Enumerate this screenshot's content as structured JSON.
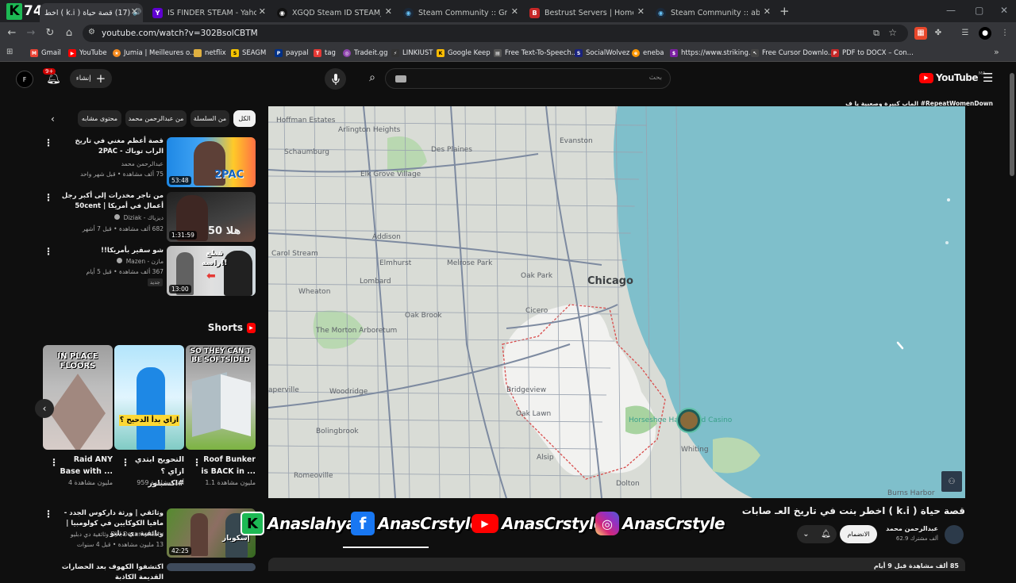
{
  "browser": {
    "tabs": [
      {
        "label": "(17) قصة حياة ( k.i ) اخط",
        "favicon": "K74 channel logo",
        "active": true
      },
      {
        "label": "IS FINDER STEAM - Yahoo Sear",
        "favicon": "Y"
      },
      {
        "label": "XGQD Steam ID STEAM_0:1:51:",
        "favicon": "steam-icon"
      },
      {
        "label": "Steam Community :: Group :: Bo",
        "favicon": "steam-icon"
      },
      {
        "label": "Bestrust Servers | Home",
        "favicon": "B"
      },
      {
        "label": "Steam Community :: abdullah.R",
        "favicon": "steam-icon"
      }
    ],
    "new_tab": "+",
    "url": "youtube.com/watch?v=302BsolCBTM",
    "bookmarks": [
      "Gmail",
      "YouTube",
      "Jumia | Meilleures o...",
      "netflix",
      "SEAGM",
      "paypal",
      "tag",
      "Tradeit.gg",
      "LINKIUST",
      "Google Keep",
      "Free Text-To-Speech...",
      "SocialWolvez",
      "eneba",
      "https://www.striking...",
      "Free Cursor Downlo...",
      "PDF to DOCX – Con..."
    ]
  },
  "logo_badge": {
    "k": "K",
    "num": "74"
  },
  "youtube": {
    "logo_text": "YouTube",
    "country": "MA",
    "search_placeholder": "بحث",
    "create_label": "إنشاء",
    "notif_count": "9+",
    "avatar_letter": "F",
    "video_tag_line": "الماب كبيرة وصعبية يا ف  #RepeatWomenDown",
    "chips": [
      "الكل",
      "من السلسلة",
      "من عبدالرحمن محمد",
      "محتوى مشابه"
    ],
    "related": [
      {
        "title": "قصة أعظم مغني في تاريخ الراب توباك - 2PAC",
        "channel": "عبدالرحمن محمد",
        "meta": "75 ألف مشاهدة • قبل شهر واحد",
        "duration": "53:48"
      },
      {
        "title": "من تاجر مخدرات إلى أكبر رجل أعمال في أمريكا | 50cent",
        "channel": "ديزياك - Diziak",
        "meta": "682 ألف مشاهدة • قبل 7 أشهر",
        "duration": "1:31:59"
      },
      {
        "title": "شو سفير بأمريكا!!",
        "channel": "مازن - Mazen",
        "meta": "367 ألف مشاهدة • قبل 5 أيام",
        "badge": "جديد",
        "duration": "13:00"
      }
    ],
    "shorts_title": "Shorts",
    "shorts": [
      {
        "title": "Roof Bunker is BACK in ...",
        "views": "1.1 مليون مشاهدة",
        "overlay": "SO THEY CAN'T BE SOFTSIDED"
      },
      {
        "title": "التحويج ابتدي ازاي ؟ #اكسبلور",
        "views": "959 ألف مشاهدة",
        "overlay": "ازاي بدأ الدحيح ؟"
      },
      {
        "title": "Raid ANY Base with ...",
        "views": "4 مليون مشاهدة",
        "overlay": "IN PLACE FLOORS"
      }
    ],
    "related_more": [
      {
        "title": "وثائقي | ورثة داركوس الجدد - مافيا الكوكايين في كولومبيا | وثائقية دي دبليو",
        "channel": "DW Documentary وثائقية دي دبليو",
        "meta": "13 مليون مشاهدة • قبل 4 سنوات",
        "duration": "42:25"
      },
      {
        "title": "اكتشفوا الكهوف بعد الحضارات القديمة الكاذبة"
      }
    ],
    "video": {
      "title": "قصة حياة ( k.i ) اخطر بنت في تاريخ العـ صابات",
      "channel": "عبدالرحمن محمد",
      "subs": "62.9 ألف مشترك",
      "join": "الانضمام",
      "desc_start": "85 ألف مشاهدة قبل 9 أيام"
    }
  },
  "map": {
    "labels": [
      "Hoffman Estates",
      "Arlington Heights",
      "Des Plaines",
      "Evanston",
      "Schaumburg",
      "Elk Grove Village",
      "Addison",
      "Carol Stream",
      "Elmhurst",
      "Melrose Park",
      "Oak Park",
      "Chicago",
      "Wheaton",
      "Lombard",
      "Oak Brook",
      "Cicero",
      "The Morton Arboretum",
      "Bridgeview",
      "Oak Lawn",
      "Woodridge",
      "aperville",
      "Bolingbrook",
      "Alsip",
      "Horseshoe Hammond Casino",
      "Whiting",
      "Romeoville",
      "Dolton",
      "Burns Harbor"
    ],
    "chicago_label": "Chicago"
  },
  "banner": {
    "handles": [
      "Anaslahya",
      "AnasCrstyle",
      "AnasCrstyle",
      "AnasCrstyle"
    ]
  }
}
